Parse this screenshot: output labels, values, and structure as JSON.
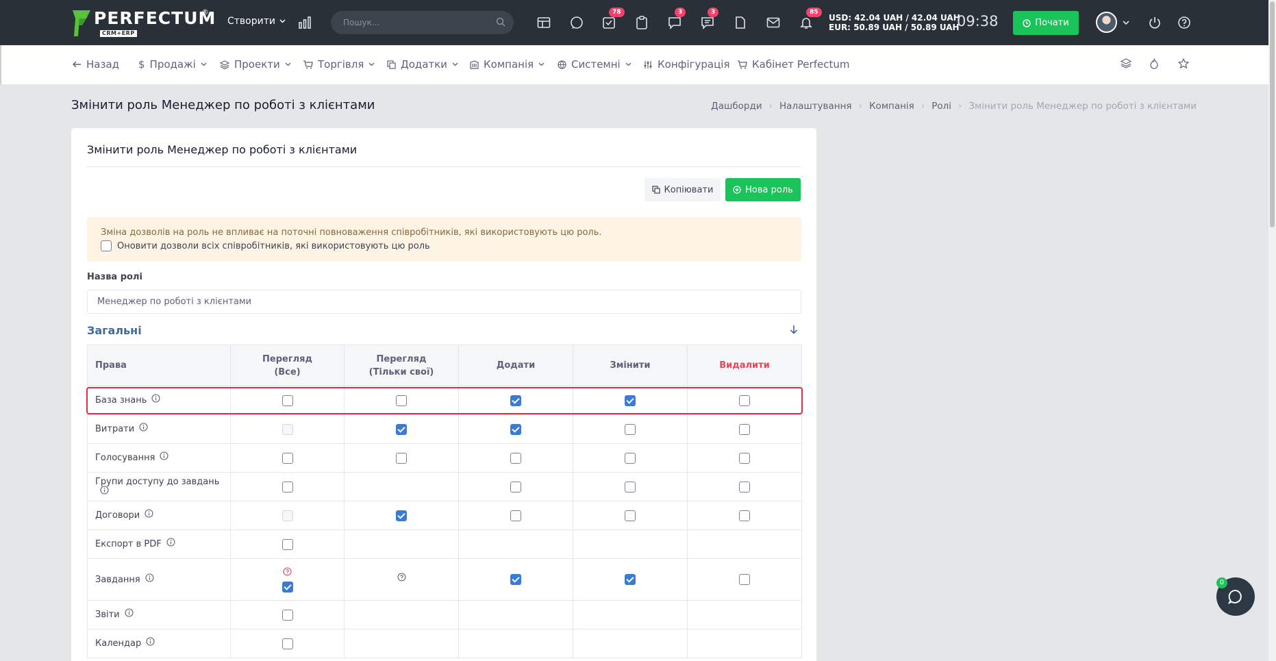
{
  "topbar": {
    "logo_text": "PERFECTUM",
    "logo_sub": "CRM+ERP",
    "logo_reg": "®",
    "create_label": "Створити",
    "search_placeholder": "Пошук...",
    "badges": {
      "tasks": "78",
      "comments": "3",
      "messages": "3",
      "notifications": "85"
    },
    "currency_usd": "USD: 42.04 UAH / 42.04 UAH",
    "currency_eur": "EUR: 50.89 UAH / 50.89 UAH",
    "time": "09:38",
    "start_label": "Почати",
    "icons": [
      "chart-icon",
      "search-icon",
      "calendar-icon",
      "chat-icon",
      "tasks-icon",
      "clipboard-icon",
      "comments-icon",
      "messages-icon",
      "file-icon",
      "mail-icon",
      "bell-icon",
      "clock-icon",
      "power-icon",
      "help-icon"
    ]
  },
  "nav": {
    "back": "Назад",
    "sales": "Продажі",
    "projects": "Проекти",
    "trade": "Торгівля",
    "addons": "Додатки",
    "company": "Компанія",
    "system": "Системні",
    "config": "Конфігурація",
    "cabinet": "Кабінет Perfectum"
  },
  "page": {
    "title": "Змінити роль Менеджер по роботі з клієнтами",
    "breadcrumb": [
      "Дашборди",
      "Налаштування",
      "Компанія",
      "Ролі",
      "Змінити роль Менеджер по роботі з клієнтами"
    ]
  },
  "card": {
    "title": "Змінити роль Менеджер по роботі з клієнтами",
    "copy_label": "Копіювати",
    "new_role_label": "Нова роль",
    "alert_text": "Зміна дозволів на роль не впливає на поточні повноваження співробітників, які використовують цю роль.",
    "alert_checkbox_label": "Оновити дозволи всіх співробітників, які використовують цю роль",
    "alert_checkbox_checked": false,
    "role_name_label": "Назва ролі",
    "role_name_value": "Менеджер по роботі з клієнтами",
    "section_title": "Загальні"
  },
  "table": {
    "headers": {
      "rights": "Права",
      "view_all": "Перегляд",
      "view_all_sub": "(Все)",
      "view_own": "Перегляд",
      "view_own_sub": "(Тільки свої)",
      "add": "Додати",
      "edit": "Змінити",
      "delete": "Видалити"
    },
    "rows": [
      {
        "name": "База знань",
        "cells": [
          "unchecked",
          "unchecked",
          "checked",
          "checked",
          "unchecked"
        ]
      },
      {
        "name": "Витрати",
        "cells": [
          "disabled",
          "checked",
          "checked",
          "unchecked",
          "unchecked"
        ]
      },
      {
        "name": "Голосування",
        "cells": [
          "unchecked",
          "unchecked",
          "unchecked",
          "unchecked",
          "unchecked"
        ]
      },
      {
        "name": "Групи доступу до завдань",
        "cells": [
          "unchecked",
          "none",
          "unchecked",
          "unchecked",
          "unchecked"
        ]
      },
      {
        "name": "Договори",
        "cells": [
          "disabled",
          "checked",
          "unchecked",
          "unchecked",
          "unchecked"
        ]
      },
      {
        "name": "Експорт в PDF",
        "cells": [
          "unchecked",
          "none",
          "none",
          "none",
          "none"
        ]
      },
      {
        "name": "Завдання",
        "cells": [
          "question-checked",
          "question",
          "checked",
          "checked",
          "unchecked"
        ]
      },
      {
        "name": "Звіти",
        "cells": [
          "unchecked",
          "none",
          "none",
          "none",
          "none"
        ]
      },
      {
        "name": "Календар",
        "cells": [
          "unchecked",
          "none",
          "none",
          "none",
          "none"
        ]
      }
    ]
  },
  "chat": {
    "badge": "0"
  }
}
